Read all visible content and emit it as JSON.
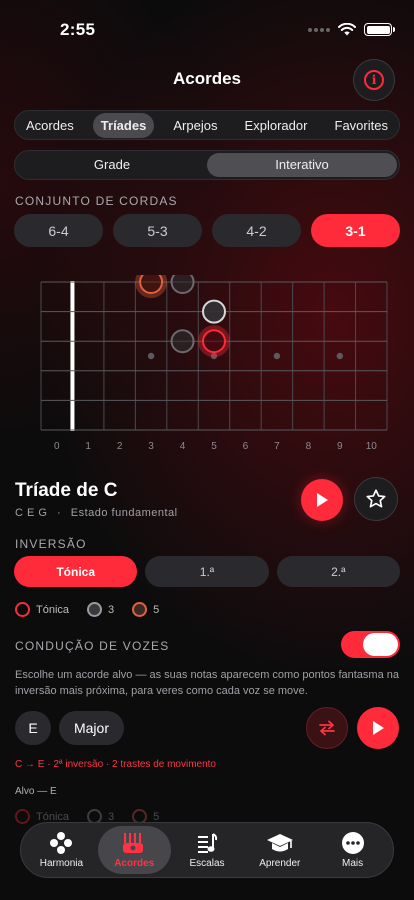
{
  "status_bar": {
    "time": "2:55"
  },
  "header": {
    "title": "Acordes",
    "info_icon": "info-icon"
  },
  "top_tabs": [
    "Acordes",
    "Tríades",
    "Arpejos",
    "Explorador",
    "Favorites"
  ],
  "top_tabs_active": "Tríades",
  "mode_tabs": [
    "Grade",
    "Interativo"
  ],
  "mode_active": "Interativo",
  "string_set": {
    "label": "CONJUNTO DE CORDAS",
    "options": [
      "6-4",
      "5-3",
      "4-2",
      "3-1"
    ],
    "active": "3-1"
  },
  "fretboard": {
    "fret_numbers": [
      "0",
      "1",
      "2",
      "3",
      "4",
      "5",
      "6",
      "7",
      "8",
      "9",
      "10"
    ],
    "notes": [
      {
        "string": 1,
        "fret": 3,
        "role": "root"
      },
      {
        "string": 1,
        "fret": 4,
        "role": "ghost"
      },
      {
        "string": 2,
        "fret": 5,
        "role": "fifth"
      },
      {
        "string": 3,
        "fret": 4,
        "role": "ghost"
      },
      {
        "string": 3,
        "fret": 5,
        "role": "root"
      }
    ]
  },
  "chord": {
    "name": "Tríade de C",
    "notes": "C  E  G",
    "separator": "·",
    "position": "Estado fundamental"
  },
  "inversion": {
    "label": "INVERSÃO",
    "options": [
      "Tónica",
      "1.ª",
      "2.ª"
    ],
    "active": "Tónica"
  },
  "legend": {
    "root": "Tónica",
    "third": "3",
    "fifth": "5"
  },
  "voice_leading": {
    "label": "CONDUÇÃO DE VOZES",
    "enabled": true,
    "description": "Escolhe um acorde alvo — as suas notas aparecem como pontos fantasma na inversão mais próxima, para veres como cada voz se move.",
    "target_key": "E",
    "target_quality": "Major",
    "movement": "C → E · 2ª inversão · 2 trastes de movimento",
    "target_label": "Alvo — E"
  },
  "colors": {
    "accent": "#ff2a3a",
    "root": "#ff2a3a",
    "third": "#9a9a9f",
    "fifth": "#e0623f"
  },
  "tabbar": {
    "items": [
      {
        "label": "Harmonia",
        "icon": "harmony-icon"
      },
      {
        "label": "Acordes",
        "icon": "guitar-icon"
      },
      {
        "label": "Escalas",
        "icon": "scales-icon"
      },
      {
        "label": "Aprender",
        "icon": "graduation-cap-icon"
      },
      {
        "label": "Mais",
        "icon": "more-icon"
      }
    ],
    "active": "Acordes"
  }
}
